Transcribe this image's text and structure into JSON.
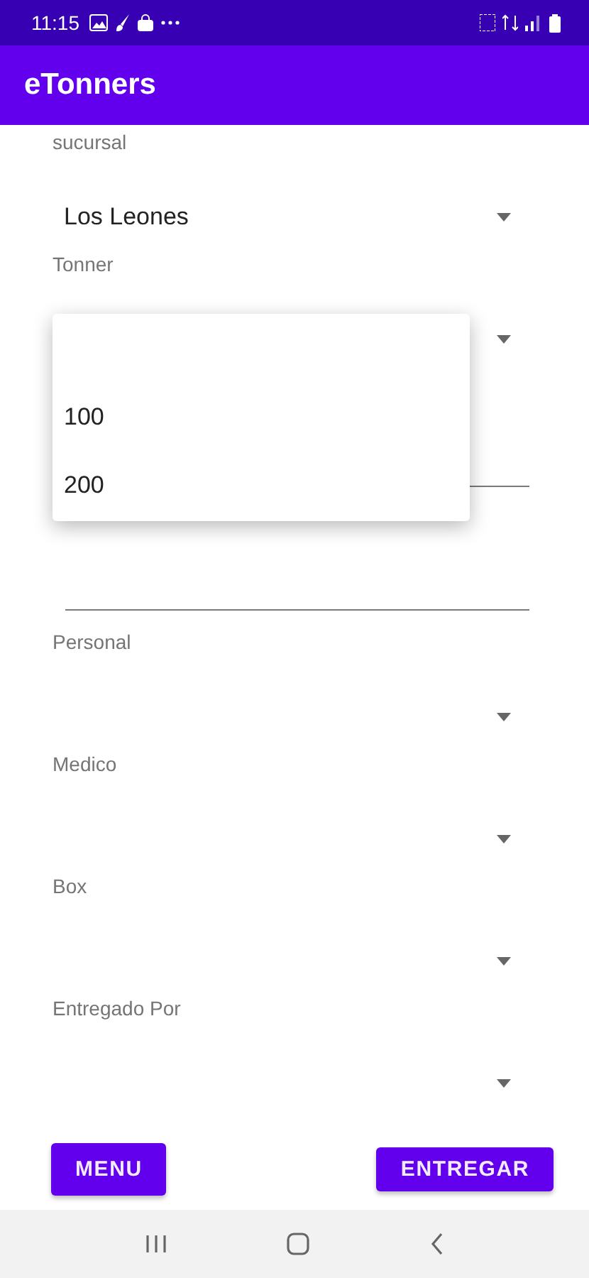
{
  "status_bar": {
    "time": "11:15"
  },
  "app_bar": {
    "title": "eTonners"
  },
  "form": [
    {
      "kind": "spinner",
      "label": "sucursal",
      "value": "Los Leones"
    },
    {
      "kind": "spinner",
      "label": "Tonner",
      "options": [
        "100",
        "200"
      ]
    },
    {
      "kind": "text_field"
    },
    {
      "kind": "text_field"
    },
    {
      "kind": "spinner",
      "label": "Personal"
    },
    {
      "kind": "spinner",
      "label": "Medico"
    },
    {
      "kind": "spinner",
      "label": "Box"
    },
    {
      "kind": "spinner",
      "label": "Entregado Por"
    }
  ],
  "buttons": [
    "MENU",
    "ENTREGAR"
  ]
}
